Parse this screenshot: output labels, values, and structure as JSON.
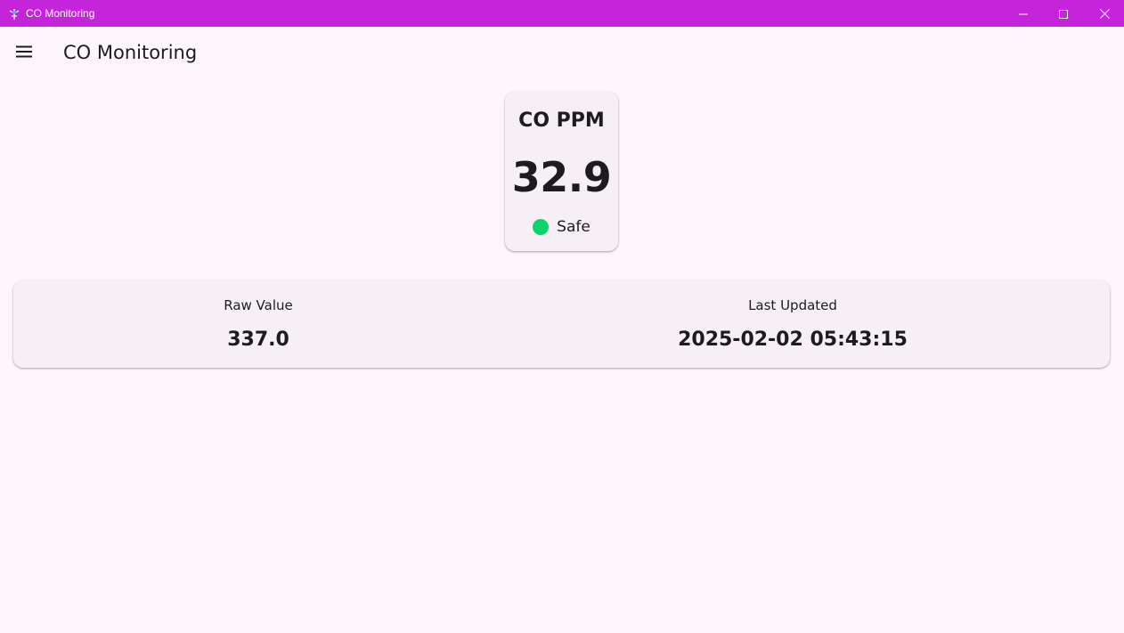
{
  "window": {
    "title": "CO Monitoring",
    "controls": [
      "minimize-icon",
      "maximize-icon",
      "close-icon"
    ]
  },
  "appbar": {
    "menu_icon": "hamburger-menu-icon",
    "title": "CO Monitoring"
  },
  "ppm_card": {
    "label": "CO PPM",
    "value": "32.9",
    "status": "Safe",
    "status_color": "#0fd26b"
  },
  "info_card": {
    "raw_label": "Raw Value",
    "raw_value": "337.0",
    "updated_label": "Last Updated",
    "updated_value": "2025-02-02 05:43:15"
  },
  "colors": {
    "titlebar": "#c425da",
    "background": "#fdf7fd",
    "card": "#f6f0f6",
    "text": "#1d1b20"
  }
}
